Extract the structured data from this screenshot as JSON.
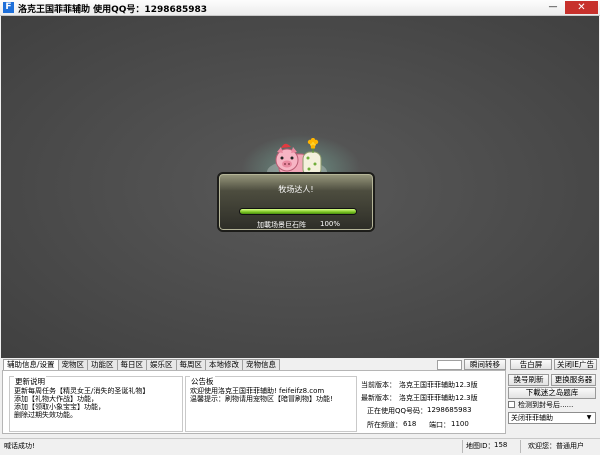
{
  "window": {
    "title": "洛克王国菲菲辅助  使用QQ号：1298685983",
    "app_icon": "F",
    "minimize_glyph": "—",
    "close_glyph": "✕"
  },
  "loading": {
    "title": "牧场达人!",
    "status": "加載场景巨石阵",
    "percent_text": "100%",
    "progress": 1.0
  },
  "tabs": [
    "辅助信息/设置",
    "宠物区",
    "功能区",
    "每日区",
    "娱乐区",
    "每周区",
    "本地修改",
    "宠物信息"
  ],
  "toolbar": {
    "instant_move": "瞬间转移",
    "alert_screen": "告白屏",
    "close_ads": "关闭IE广告"
  },
  "update_notes": {
    "label": "更新说明",
    "lines": [
      "更新每周任务【精灵女王/消失的圣诞礼物】",
      "添加【礼物大作战】功能，",
      "添加【领取小象宝宝】功能，",
      "删除过期失效功能。"
    ]
  },
  "notice": {
    "label": "公告板",
    "lines": [
      "欢迎使用洛克王国菲菲辅助! feifeifz8.com",
      "温馨提示：刷物请用宠物区【暗冒刷物】功能!"
    ]
  },
  "version_info": {
    "current_label": "当前版本：",
    "current_value": "洛克王国菲菲辅助12.3版",
    "latest_label": "最新版本：",
    "latest_value": "洛克王国菲菲辅助12.3版",
    "qq_label": "正在使用QQ号码：",
    "qq_value": "1298685983",
    "channel_label": "所在频道：",
    "channel_value": "618",
    "port_label": "端口：",
    "port_value": "1100"
  },
  "right_panel": {
    "refresh_button": "换号刷新",
    "server_button": "更换服务器",
    "download_button": "下載迷之岛题库",
    "auto_check_label": "检测到封号后......",
    "auto_check_checked": false,
    "select_value": "关闭菲菲辅助"
  },
  "statusbar": {
    "message": "喊话成功!",
    "map_label": "地图ID：",
    "map_value": "158",
    "greeting": "欢迎您：普通用户"
  },
  "colors": {
    "progress_fill": "#7ac322",
    "close_button": "#c7312c"
  }
}
